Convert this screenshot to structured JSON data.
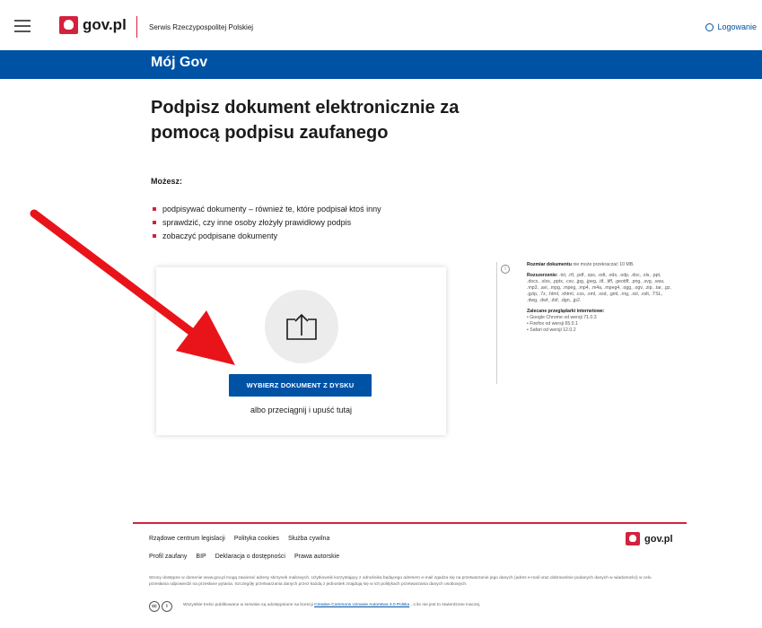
{
  "header": {
    "logo_text": "gov.pl",
    "service_name": "Serwis Rzeczypospolitej Polskiej",
    "login_label": "Logowanie"
  },
  "bluebar": {
    "title": "Mój Gov"
  },
  "main": {
    "title": "Podpisz dokument elektronicznie za pomocą podpisu zaufanego",
    "subtitle": "Możesz:",
    "bullets": [
      "podpisywać dokumenty – również te, które podpisał ktoś inny",
      "sprawdzić, czy inne osoby złożyły prawidłowy podpis",
      "zobaczyć podpisane dokumenty"
    ]
  },
  "upload": {
    "button_label": "WYBIERZ DOKUMENT Z DYSKU",
    "drag_text": "albo przeciągnij i upuść tutaj"
  },
  "info": {
    "size_bold": "Rozmiar dokumentu",
    "size_text": " nie może przekraczać 10 MB.",
    "ext_bold": "Rozszerzenie:",
    "ext_text": " .txt, .rtf, .pdf, .xps, .odt, .ods, .odp, .doc, .xls, .ppt, .docx, .xlsx, .pptx, .csv, .jpg, .jpeg, .tif, .tiff, .geotiff, .png, .svg, .wav, .mp3, .avi, .mpg, .mpeg, .mp4, .m4a, .mpeg4, .ogg, .ogv, .zip, .tar, .gz, .gzip, .7z, .html, .xhtml, .css, .xml, .xsd, .gml, .rng, .xsl, .xslt, .TSL, .dwg, .dwf, .dxf, .dgn, .jp2.",
    "browsers_bold": "Zalecane przeglądarki internetowe:",
    "browsers": [
      "• Google Chrome od wersji 71.0.3",
      "• Firefox od wersji 65.0.1",
      "• Safari od wersji 12.0.2"
    ]
  },
  "footer": {
    "links_row1": [
      "Rządowe centrum legislacji",
      "Polityka cookies",
      "Służba cywilna"
    ],
    "links_row2": [
      "Profil zaufany",
      "BIP",
      "Deklaracja o dostępności",
      "Prawa autorskie"
    ],
    "logo_text": "gov.pl",
    "notice": "Strony dostępne w domenie www.gov.pl mogą zawierać adresy skrzynek mailowych. Użytkownik korzystający z odnośnika będącego adresem e-mail zgadza się na przetwarzanie jego danych (adres e-mail oraz dobrowolnie podanych danych w wiadomości) w celu przesłania odpowiedzi na przesłane pytania. Szczegóły przetwarzania danych przez każdą z jednostek znajdują się w ich politykach przetwarzania danych osobowych.",
    "license_prefix": "Wszystkie treści publikowane w serwisie są udostępniane na licencji ",
    "license_link": "Creative Commons Uznanie Autorstwa 3.0 Polska",
    "license_suffix": " , o ile nie jest to stwierdzone inaczej."
  },
  "colors": {
    "brand_blue": "#0052a5",
    "brand_red": "#d4213d",
    "arrow_red": "#e8141a"
  }
}
